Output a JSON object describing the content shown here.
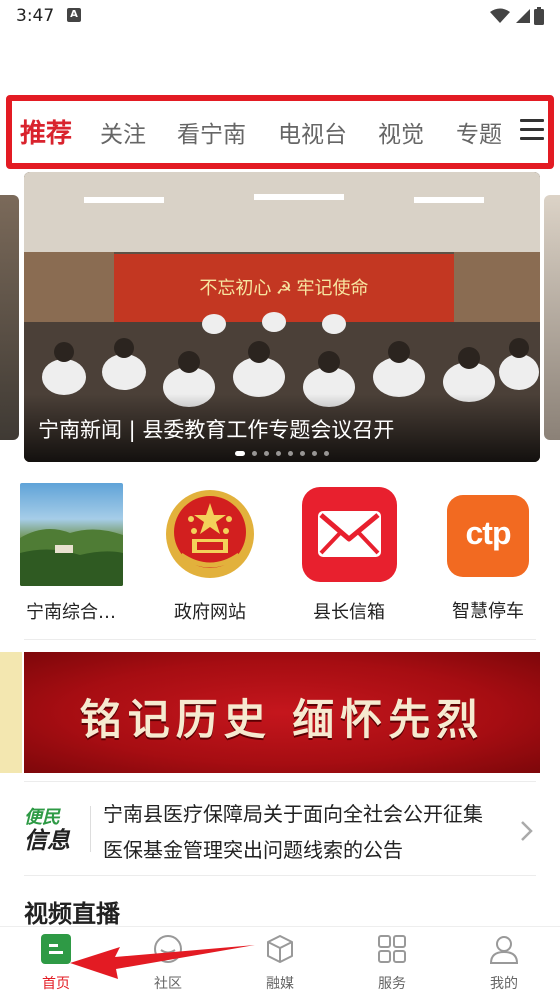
{
  "status_bar": {
    "time": "3:47",
    "notification_badge": "A"
  },
  "tabs": [
    {
      "label": "推荐",
      "active": true
    },
    {
      "label": "关注",
      "active": false
    },
    {
      "label": "看宁南",
      "active": false
    },
    {
      "label": "电视台",
      "active": false
    },
    {
      "label": "视觉",
      "active": false
    },
    {
      "label": "专题",
      "active": false
    }
  ],
  "banner": {
    "caption": "宁南新闻 | 县委教育工作专题会议召开",
    "wall_slogan": "不忘初心 ☭ 牢记使命",
    "slide_count": 8,
    "active_slide": 0
  },
  "quick_links": [
    {
      "label": "宁南综合…",
      "icon": "landscape-photo-icon"
    },
    {
      "label": "政府网站",
      "icon": "national-emblem-icon"
    },
    {
      "label": "县长信箱",
      "icon": "mail-envelope-icon"
    },
    {
      "label": "智慧停车",
      "icon": "ctp-parking-icon",
      "icon_text": "ctp"
    }
  ],
  "poster": {
    "text": "铭记历史 缅怀先烈"
  },
  "notice": {
    "logo_line1": "便民",
    "logo_line2": "信息",
    "text": "宁南县医疗保障局关于面向全社会公开征集医保基金管理突出问题线索的公告"
  },
  "section": {
    "title": "视频直播"
  },
  "bottom_nav": [
    {
      "label": "首页",
      "icon": "home-icon",
      "active": true
    },
    {
      "label": "社区",
      "icon": "community-icon",
      "active": false
    },
    {
      "label": "融媒",
      "icon": "media-cube-icon",
      "active": false
    },
    {
      "label": "服务",
      "icon": "grid-services-icon",
      "active": false
    },
    {
      "label": "我的",
      "icon": "profile-icon",
      "active": false
    }
  ],
  "colors": {
    "accent_red": "#e31b23",
    "active_green": "#2e9a45"
  }
}
